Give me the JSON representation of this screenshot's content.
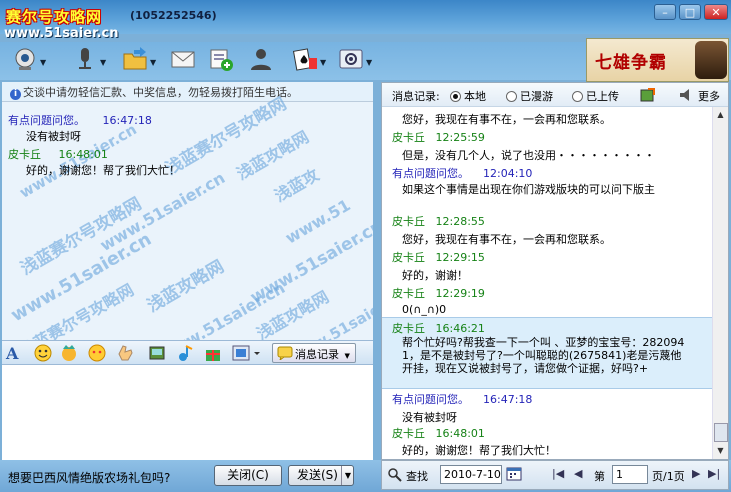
{
  "window": {
    "title": "赛尔号攻略网",
    "qq": "(1052252546)",
    "site_url": "www.51saier.cn"
  },
  "icons": {
    "title_buttons": [
      "minimize-icon",
      "maximize-icon",
      "close-icon"
    ],
    "toolbar": [
      "webcam-icon",
      "microphone-icon",
      "folder-transfer-icon",
      "email-icon",
      "add-contact-icon",
      "user-info-icon",
      "game-cards-icon",
      "app-settings-icon"
    ]
  },
  "ad": {
    "text": "七雄争霸"
  },
  "left": {
    "notice": "交谈中请勿轻信汇款、中奖信息，勿轻易拨打陌生电话。",
    "watermarks": [
      "浅蓝赛尔号攻略网",
      "www.51saier.cn",
      "浅蓝攻略网",
      "www.51saier.cn",
      "浅蓝攻",
      "www.51",
      "浅蓝赛尔号攻略网",
      "www.51saier.cn",
      "浅蓝攻略网",
      "www.51saier.cn",
      "浅蓝赛尔号攻略网",
      "www.51saier.cn",
      "浅蓝攻略网",
      "www.51saier.cn"
    ],
    "messages": [
      {
        "sender": "有点问题问您。",
        "time": "16:47:18",
        "text": "没有被封呀",
        "color": "blue"
      },
      {
        "sender": "皮卡丘",
        "time": "16:48:01",
        "text": "好的，谢谢您！帮了我们大忙！",
        "color": "green"
      }
    ]
  },
  "format_bar": {
    "icons": [
      "font-icon",
      "smiley-icon",
      "magic-face-icon",
      "gift-face-icon",
      "hand-icon",
      "screenshot-icon",
      "music-icon",
      "present-icon",
      "scissors-icon"
    ],
    "msg_record_label": "消息记录"
  },
  "bottom": {
    "ad_text": "想要巴西风情绝版农场礼包吗?",
    "close_label": "关闭(C)",
    "send_label": "发送(S)"
  },
  "history": {
    "title": "消息记录:",
    "tabs": [
      {
        "label": "本地",
        "selected": true
      },
      {
        "label": "已漫游",
        "selected": false
      },
      {
        "label": "已上传",
        "selected": false
      }
    ],
    "more_label": "更多",
    "entries": [
      {
        "sender": "",
        "time": "",
        "text": "您好，我现在有事不在，一会再和您联系。"
      },
      {
        "sender": "皮卡丘",
        "time": "12:25:59",
        "text": "但是，没有几个人，说了也没用・・・・・・・・・",
        "color": "green"
      },
      {
        "sender": "有点问题问您。",
        "time": "12:04:10",
        "text": "如果这个事情是出现在你们游戏版块的可以问下版主",
        "color": "blue"
      },
      {
        "sender": "皮卡丘",
        "time": "12:28:55",
        "text": "您好，我现在有事不在，一会再和您联系。",
        "color": "green"
      },
      {
        "sender": "皮卡丘",
        "time": "12:29:15",
        "text": "好的，谢谢！",
        "color": "green"
      },
      {
        "sender": "皮卡丘",
        "time": "12:29:19",
        "text": "0(∩_∩)0",
        "color": "green"
      },
      {
        "sender": "皮卡丘",
        "time": "16:46:21",
        "text": "帮个忙好吗?帮我查一下一个叫 、亚梦的宝宝号：2820941，是不是被封号了?一个叫聪聪的(2675841)老是污蔑他开挂，现在又说被封号了，请您做个证据，好吗?+",
        "color": "green"
      },
      {
        "sender": "有点问题问您。",
        "time": "16:47:18",
        "text": "没有被封呀",
        "color": "blue"
      },
      {
        "sender": "皮卡丘",
        "time": "16:48:01",
        "text": "好的，谢谢您！帮了我们大忙！",
        "color": "green"
      }
    ],
    "footer": {
      "search_label": "查找",
      "date": "2010-7-10",
      "page_prefix": "第",
      "page": "1",
      "page_total": "页/1页"
    }
  }
}
